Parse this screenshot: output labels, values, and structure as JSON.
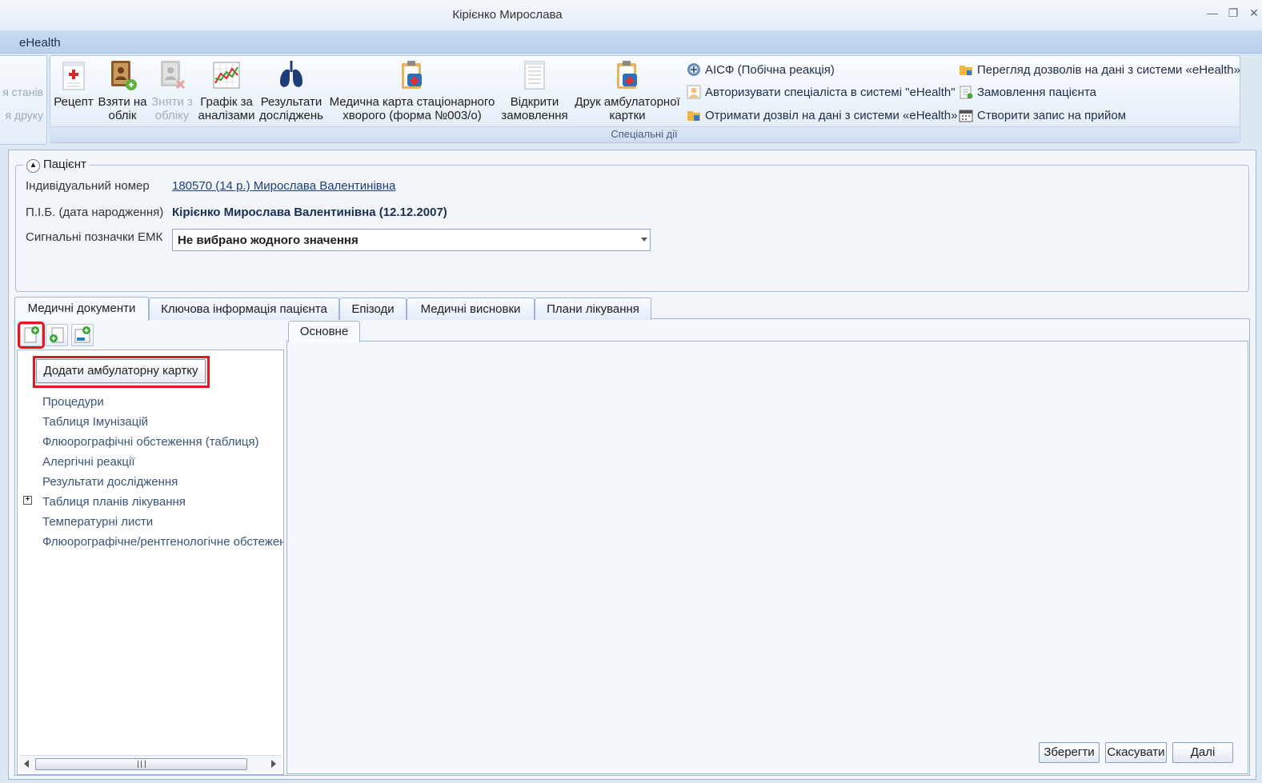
{
  "window": {
    "title": "Кірієнко Мирослава"
  },
  "menu": {
    "ehealth": "eHealth"
  },
  "ribbon_left": {
    "line1": "я станів",
    "line2": "я друку"
  },
  "ribbon": {
    "buttons": [
      {
        "label1": "Рецепт",
        "label2": "",
        "icon": "prescription-icon"
      },
      {
        "label1": "Взяти на",
        "label2": "облік",
        "icon": "register-book-icon"
      },
      {
        "label1": "Зняти з",
        "label2": "обліку",
        "icon": "unregister-icon",
        "disabled": true
      },
      {
        "label1": "Графік за",
        "label2": "аналізами",
        "icon": "chart-icon"
      },
      {
        "label1": "Результати",
        "label2": "досліджень",
        "icon": "lungs-icon"
      },
      {
        "label1": "Медична карта стаціонарного",
        "label2": "хворого (форма №003/о)",
        "icon": "medical-card-icon"
      },
      {
        "label1": "Відкрити",
        "label2": "замовлення",
        "icon": "document-icon"
      },
      {
        "label1": "Друк амбулаторної",
        "label2": "картки",
        "icon": "print-card-icon"
      }
    ],
    "small_buttons_col1": [
      {
        "label": "АІСФ (Побічна реакція)",
        "icon": "emblem-icon"
      },
      {
        "label": "Авторизувати спеціаліста в системі \"eHealth\"",
        "icon": "user-auth-icon"
      },
      {
        "label": "Отримати дозвіл на дані з системи «eHealth»",
        "icon": "permission-folder-icon"
      }
    ],
    "small_buttons_col2": [
      {
        "label": "Перегляд дозволів на дані з системи «eHealth»",
        "icon": "folder-lock-icon"
      },
      {
        "label": "Замовлення пацієнта",
        "icon": "order-icon"
      },
      {
        "label": "Створити запис на прийом",
        "icon": "calendar-icon"
      }
    ],
    "group_label": "Спеціальні дії"
  },
  "patient": {
    "legend": "Пацієнт",
    "id_label": "Індивідуальний номер",
    "id_value": "180570 (14 р.) Мирослава Валентинівна",
    "name_label": "П.І.Б. (дата народження)",
    "name_value": "Кірієнко Мирослава Валентинівна (12.12.2007)",
    "emk_label": "Сигнальні позначки ЕМК",
    "emk_value": "Не вибрано жодного значення"
  },
  "tabs": [
    "Медичні документи",
    "Ключова інформація пацієнта",
    "Епізоди",
    "Медичні висновки",
    "Плани лікування"
  ],
  "tooltip": "Додати амбулаторну картку",
  "tree": [
    {
      "label": "Процедури"
    },
    {
      "label": "Таблиця Імунізацій"
    },
    {
      "label": "Флюорографічні обстеження (таблиця)"
    },
    {
      "label": "Алергічні реакції"
    },
    {
      "label": "Результати дослідження"
    },
    {
      "label": "Таблиця планів лікування",
      "expander": "+"
    },
    {
      "label": "Температурні листи"
    },
    {
      "label": "Флюорографічне/рентгенологічне обстеження"
    }
  ],
  "subtab": "Основне",
  "actions": {
    "save": "Зберегти",
    "cancel": "Скасувати",
    "next": "Далі"
  }
}
